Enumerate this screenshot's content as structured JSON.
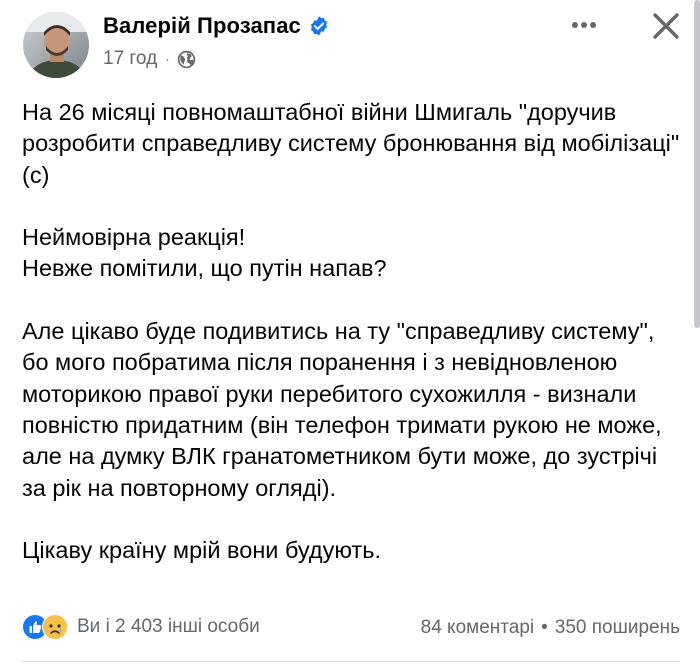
{
  "header": {
    "author_name": "Валерій Прозапас",
    "verified_icon": "verified-badge-icon",
    "time": "17 год",
    "privacy_icon": "globe-icon",
    "more_icon": "more-dots-icon",
    "close_icon": "close-icon"
  },
  "post": {
    "paragraphs": [
      "На 26 місяці повномаштабної війни Шмигаль \"доручив розробити справедливу систему бронювання від мобілізаці\" (с)",
      "Неймовірна реакція!\nНевже помітили, що путін напав?",
      "Але цікаво буде подивитись на ту \"справедливу систему\", бо мого побратима після поранення  і з невідновленою моторикою правої руки перебитого сухожилля - визнали повністю придатним (він телефон тримати рукою не може, але на думку ВЛК гранатометником бути може, до зустрічі за рік на повторному огляді).",
      "Цікаву країну мрій вони будують."
    ]
  },
  "footer": {
    "reaction_icons": [
      "like-icon",
      "sad-icon"
    ],
    "reactions_text": "Ви і 2 403 інші особи",
    "comments": "84 коментарі",
    "separator": "•",
    "shares": "350 поширень"
  },
  "colors": {
    "text": "#050505",
    "secondary": "#65676b",
    "brand_blue": "#1877f2",
    "sad_yellow": "#f7c04a"
  }
}
